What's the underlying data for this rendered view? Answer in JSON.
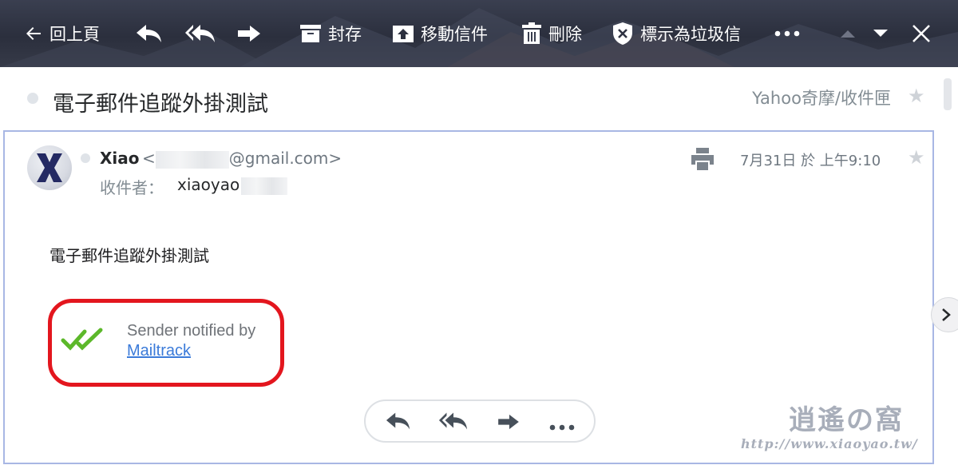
{
  "toolbar": {
    "back_label": "回上頁",
    "archive_label": "封存",
    "move_label": "移動信件",
    "delete_label": "刪除",
    "spam_label": "標示為垃圾信"
  },
  "header": {
    "subject": "電子郵件追蹤外掛測試",
    "folder": "Yahoo奇摩/收件匣"
  },
  "message": {
    "sender_name": "Xiao",
    "sender_email_prefix": "<",
    "sender_email_suffix": "@gmail.com>",
    "to_label": "收件者：",
    "to_value": "xiaoyao",
    "date": "7月31日 於 上午9:10",
    "body": "電子郵件追蹤外掛測試",
    "mailtrack_text": "Sender notified by",
    "mailtrack_link": "Mailtrack"
  },
  "watermark": {
    "title": "逍遙の窩",
    "url": "http://www.xiaoyao.tw/"
  },
  "colors": {
    "toolbar_bg": "#2f3342",
    "card_border": "#a8b7e4",
    "highlight_red": "#e3161e",
    "check_green": "#5cb82a",
    "link_blue": "#3b7bd9"
  }
}
